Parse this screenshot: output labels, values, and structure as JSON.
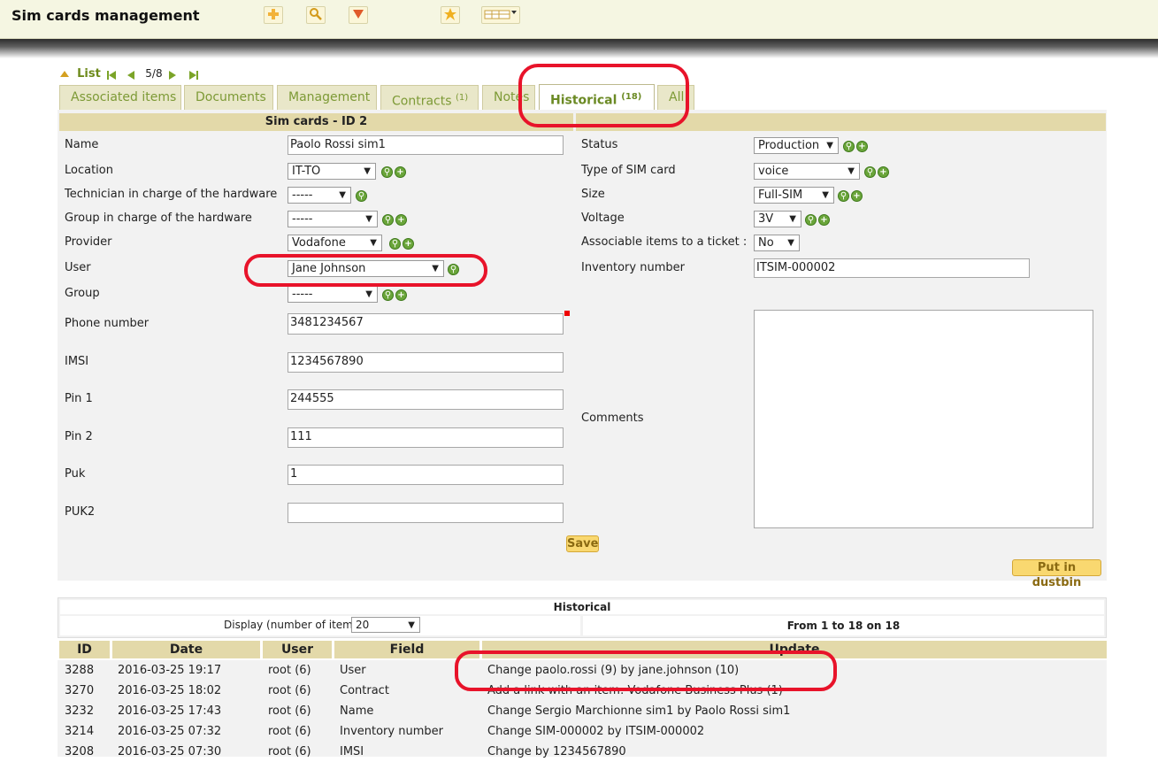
{
  "app": {
    "title": "Sim cards management"
  },
  "toolbar": {
    "icons": [
      "add-icon",
      "search-icon",
      "tree-icon",
      "star-icon",
      "list-display-icon"
    ]
  },
  "nav": {
    "list_label": "List",
    "position": "5/8"
  },
  "tabs": [
    {
      "label": "Associated items",
      "count": ""
    },
    {
      "label": "Documents",
      "count": ""
    },
    {
      "label": "Management",
      "count": ""
    },
    {
      "label": "Contracts",
      "count": "(1)"
    },
    {
      "label": "Notes",
      "count": ""
    },
    {
      "label": "Historical",
      "count": "(18)"
    },
    {
      "label": "All",
      "count": ""
    }
  ],
  "form": {
    "header": "Sim cards - ID 2",
    "left": {
      "name_label": "Name",
      "name_value": "Paolo Rossi sim1",
      "location_label": "Location",
      "location_value": "IT-TO",
      "tech_label": "Technician in charge of the hardware",
      "tech_value": "-----",
      "group_hw_label": "Group in charge of the hardware",
      "group_hw_value": "-----",
      "provider_label": "Provider",
      "provider_value": "Vodafone",
      "user_label": "User",
      "user_value": "Jane Johnson",
      "group_label": "Group",
      "group_value": "-----",
      "phone_label": "Phone number",
      "phone_value": "3481234567",
      "imsi_label": "IMSI",
      "imsi_value": "1234567890",
      "pin1_label": "Pin 1",
      "pin1_value": "244555",
      "pin2_label": "Pin 2",
      "pin2_value": "111",
      "puk_label": "Puk",
      "puk_value": "1",
      "puk2_label": "PUK2",
      "puk2_value": ""
    },
    "right": {
      "status_label": "Status",
      "status_value": "Production",
      "type_label": "Type of SIM card",
      "type_value": "voice",
      "size_label": "Size",
      "size_value": "Full-SIM",
      "voltage_label": "Voltage",
      "voltage_value": "3V",
      "assoc_label": "Associable items to a ticket :",
      "assoc_value": "No",
      "inventory_label": "Inventory number",
      "inventory_value": "ITSIM-000002",
      "comments_label": "Comments"
    },
    "save_label": "Save",
    "dustbin_label": "Put in dustbin"
  },
  "historical": {
    "title": "Historical",
    "display_label": "Display (number of items)",
    "display_value": "20",
    "range_text": "From 1 to 18 on 18",
    "columns": [
      "ID",
      "Date",
      "User",
      "Field",
      "Update"
    ],
    "rows": [
      {
        "id": "3288",
        "date": "2016-03-25 19:17",
        "user": "root (6)",
        "field": "User",
        "update": "Change paolo.rossi (9) by jane.johnson (10)"
      },
      {
        "id": "3270",
        "date": "2016-03-25 18:02",
        "user": "root (6)",
        "field": "Contract",
        "update": "Add a link with an item: Vodafone Business Plus (1)"
      },
      {
        "id": "3232",
        "date": "2016-03-25 17:43",
        "user": "root (6)",
        "field": "Name",
        "update": "Change Sergio Marchionne sim1 by Paolo Rossi sim1"
      },
      {
        "id": "3214",
        "date": "2016-03-25 07:32",
        "user": "root (6)",
        "field": "Inventory number",
        "update": "Change SIM-000002 by ITSIM-000002"
      },
      {
        "id": "3208",
        "date": "2016-03-25 07:30",
        "user": "root (6)",
        "field": "IMSI",
        "update": "Change by 1234567890"
      }
    ]
  }
}
